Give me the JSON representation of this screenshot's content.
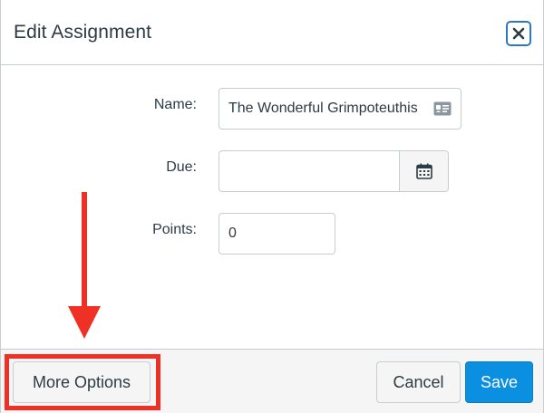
{
  "dialog": {
    "title": "Edit Assignment",
    "close_icon": "close-icon"
  },
  "form": {
    "name_label": "Name:",
    "name_value": "The Wonderful Grimpoteuthis",
    "name_icon": "contact-card-icon",
    "due_label": "Due:",
    "due_value": "",
    "due_icon": "calendar-icon",
    "points_label": "Points:",
    "points_value": "0"
  },
  "footer": {
    "more_options_label": "More Options",
    "cancel_label": "Cancel",
    "save_label": "Save"
  },
  "annotation": {
    "arrow_icon": "arrow-down-icon",
    "color": "#ee3124"
  },
  "colors": {
    "primary": "#0b8fe0",
    "close_border": "#2b7abc",
    "text": "#2d3b45",
    "border": "#c7cdd1",
    "footer_bg": "#f5f5f5"
  }
}
